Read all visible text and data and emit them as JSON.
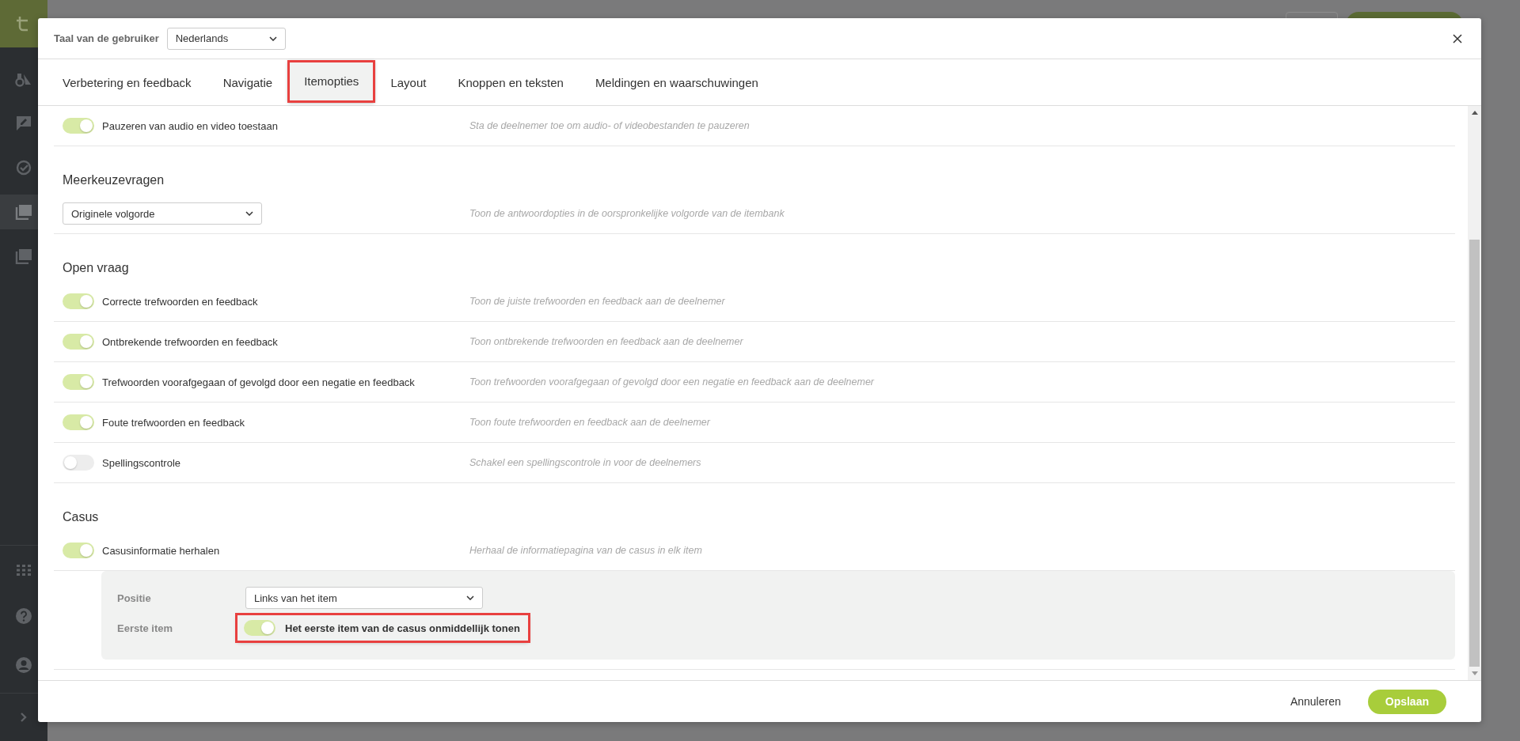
{
  "language": {
    "label": "Taal van de gebruiker",
    "value": "Nederlands"
  },
  "tabs": [
    {
      "label": "Verbetering en feedback",
      "selected": false,
      "highlighted": false
    },
    {
      "label": "Navigatie",
      "selected": false,
      "highlighted": false
    },
    {
      "label": "Itemopties",
      "selected": true,
      "highlighted": true
    },
    {
      "label": "Layout",
      "selected": false,
      "highlighted": false
    },
    {
      "label": "Knoppen en teksten",
      "selected": false,
      "highlighted": false
    },
    {
      "label": "Meldingen en waarschuwingen",
      "selected": false,
      "highlighted": false
    }
  ],
  "sections": [
    {
      "rows": [
        {
          "kind": "toggle",
          "label": "Pauzeren van audio en video toestaan",
          "on": true,
          "description": "Sta de deelnemer toe om audio- of videobestanden te pauzeren"
        }
      ]
    },
    {
      "title": "Meerkeuzevragen",
      "rows": [
        {
          "kind": "select",
          "value": "Originele volgorde",
          "description": "Toon de antwoordopties in de oorspronkelijke volgorde van de itembank"
        }
      ]
    },
    {
      "title": "Open vraag",
      "rows": [
        {
          "kind": "toggle",
          "label": "Correcte trefwoorden en feedback",
          "on": true,
          "description": "Toon de juiste trefwoorden en feedback aan de deelnemer"
        },
        {
          "kind": "toggle",
          "label": "Ontbrekende trefwoorden en feedback",
          "on": true,
          "description": "Toon ontbrekende trefwoorden en feedback aan de deelnemer"
        },
        {
          "kind": "toggle",
          "label": "Trefwoorden voorafgegaan of gevolgd door een negatie en feedback",
          "on": true,
          "description": "Toon trefwoorden voorafgegaan of gevolgd door een negatie en feedback aan de deelnemer"
        },
        {
          "kind": "toggle",
          "label": "Foute trefwoorden en feedback",
          "on": true,
          "description": "Toon foute trefwoorden en feedback aan de deelnemer"
        },
        {
          "kind": "toggle",
          "label": "Spellingscontrole",
          "on": false,
          "description": "Schakel een spellingscontrole in voor de deelnemers"
        }
      ]
    },
    {
      "title": "Casus",
      "rows": [
        {
          "kind": "toggle",
          "label": "Casusinformatie herhalen",
          "on": true,
          "description": "Herhaal de informatiepagina van de casus in elk item"
        }
      ],
      "panel": [
        {
          "kind": "select",
          "label": "Positie",
          "value": "Links van het item"
        },
        {
          "kind": "toggle",
          "label": "Eerste item",
          "on": true,
          "text": "Het eerste item van de casus onmiddellijk tonen",
          "highlighted": true
        }
      ]
    }
  ],
  "footer": {
    "cancel": "Annuleren",
    "save": "Opslaan"
  }
}
